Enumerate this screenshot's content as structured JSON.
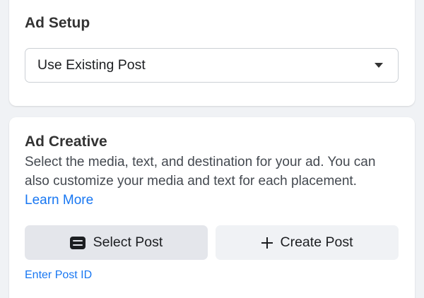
{
  "ad_setup": {
    "heading": "Ad Setup",
    "dropdown": {
      "selected_value": "Use Existing Post",
      "icon": "caret-down-icon"
    }
  },
  "ad_creative": {
    "heading": "Ad Creative",
    "description": "Select the media, text, and destination for your ad. You can also customize your media and text for each placement.",
    "learn_more": "Learn More",
    "buttons": {
      "select_post": {
        "label": "Select Post",
        "icon": "post-icon",
        "selected": true
      },
      "create_post": {
        "label": "Create Post",
        "icon": "plus-icon"
      }
    },
    "enter_post_id": "Enter Post ID"
  },
  "colors": {
    "link": "#1877f2",
    "selected_button": "#e4e6eb",
    "unselected_button": "#f0f2f5",
    "page_background": "#f0f2f5",
    "card_background": "#ffffff"
  }
}
